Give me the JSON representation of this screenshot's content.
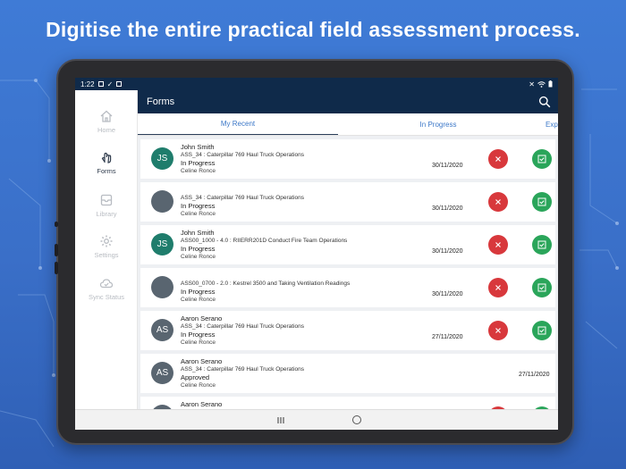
{
  "headline": "Digitise the entire practical field assessment process.",
  "status_bar": {
    "time": "1:22"
  },
  "sidebar": {
    "items": [
      {
        "label": "Home",
        "icon": "home-icon",
        "active": false
      },
      {
        "label": "Forms",
        "icon": "hand-pointer-icon",
        "active": true
      },
      {
        "label": "Library",
        "icon": "library-icon",
        "active": false
      },
      {
        "label": "Settings",
        "icon": "gear-icon",
        "active": false
      },
      {
        "label": "Sync Status",
        "icon": "cloud-sync-icon",
        "active": false
      }
    ]
  },
  "appbar": {
    "title": "Forms",
    "search_icon": "search-icon"
  },
  "tabs": [
    {
      "label": "My Recent",
      "active": true
    },
    {
      "label": "In Progress",
      "active": false
    },
    {
      "label": "Exp",
      "active": false
    }
  ],
  "rows": [
    {
      "initials": "JS",
      "name": "John Smith",
      "course": "ASS_34 : Caterpillar 769 Haul Truck Operations",
      "status": "In Progress",
      "assessor": "Celine Ronce",
      "date": "30/11/2020",
      "actions": true
    },
    {
      "initials": "",
      "name": "",
      "course": "ASS_34 : Caterpillar 769 Haul Truck Operations",
      "status": "In Progress",
      "assessor": "Celine Ronce",
      "date": "30/11/2020",
      "actions": true
    },
    {
      "initials": "JS",
      "name": "John Smith",
      "course": "ASS00_1000 - 4.0 : RIIERR201D Conduct Fire Team Operations",
      "status": "In Progress",
      "assessor": "Celine Ronce",
      "date": "30/11/2020",
      "actions": true
    },
    {
      "initials": "",
      "name": "",
      "course": "ASS00_0700 - 2.0 : Kestrel 3500 and Taking Ventilation Readings",
      "status": "In Progress",
      "assessor": "Celine Ronce",
      "date": "30/11/2020",
      "actions": true
    },
    {
      "initials": "AS",
      "name": "Aaron Serano",
      "course": "ASS_34 : Caterpillar 769 Haul Truck Operations",
      "status": "In Progress",
      "assessor": "Celine Ronce",
      "date": "27/11/2020",
      "actions": true
    },
    {
      "initials": "AS",
      "name": "Aaron Serano",
      "course": "ASS_34 : Caterpillar 769 Haul Truck Operations",
      "status": "Approved",
      "assessor": "Celine Ronce",
      "date": "27/11/2020",
      "actions": false
    },
    {
      "initials": "AS",
      "name": "Aaron Serano",
      "course": "",
      "status": "",
      "assessor": "",
      "date": "",
      "actions": true
    }
  ],
  "colors": {
    "brand_dark": "#0f2a4a",
    "reject": "#d8383c",
    "approve": "#2aa55a",
    "tab_text": "#3c78c8"
  }
}
